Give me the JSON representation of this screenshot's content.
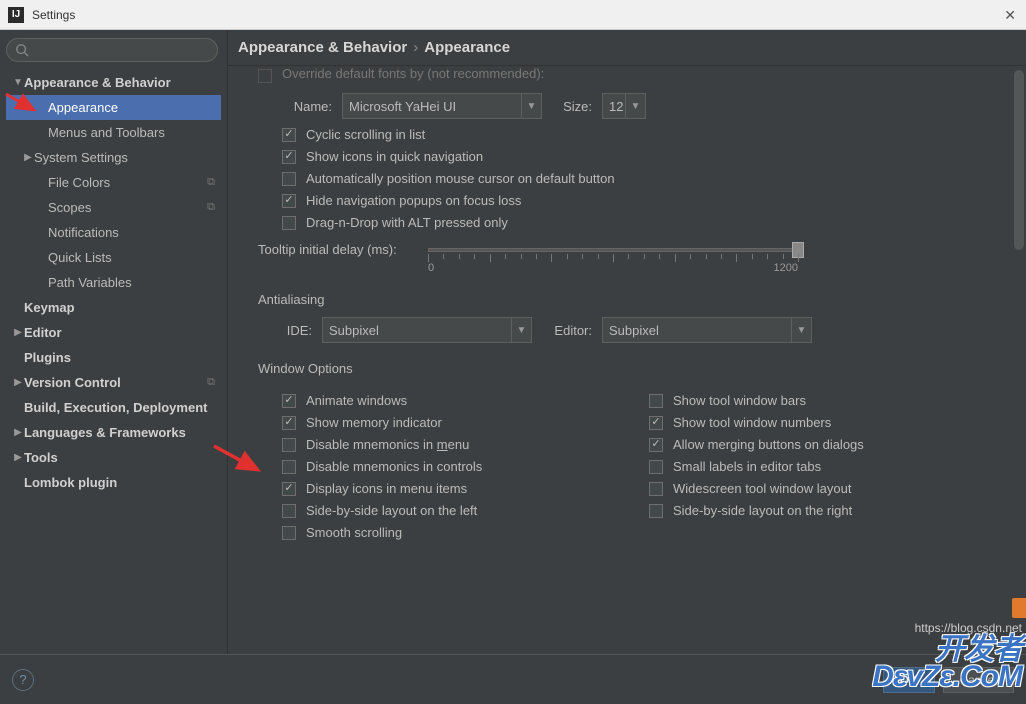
{
  "window": {
    "title": "Settings"
  },
  "breadcrumb": {
    "root": "Appearance & Behavior",
    "leaf": "Appearance"
  },
  "sidebar": {
    "items": [
      {
        "label": "Appearance & Behavior",
        "bold": true,
        "arrow": "down"
      },
      {
        "label": "Appearance",
        "child": true,
        "selected": true
      },
      {
        "label": "Menus and Toolbars",
        "child": true
      },
      {
        "label": "System Settings",
        "child": true,
        "arrow": "right"
      },
      {
        "label": "File Colors",
        "child": true,
        "badge": true
      },
      {
        "label": "Scopes",
        "child": true,
        "badge": true
      },
      {
        "label": "Notifications",
        "child": true
      },
      {
        "label": "Quick Lists",
        "child": true
      },
      {
        "label": "Path Variables",
        "child": true
      },
      {
        "label": "Keymap",
        "bold": true
      },
      {
        "label": "Editor",
        "bold": true,
        "arrow": "right"
      },
      {
        "label": "Plugins",
        "bold": true
      },
      {
        "label": "Version Control",
        "bold": true,
        "arrow": "right",
        "badge": true
      },
      {
        "label": "Build, Execution, Deployment",
        "bold": true
      },
      {
        "label": "Languages & Frameworks",
        "bold": true,
        "arrow": "right"
      },
      {
        "label": "Tools",
        "bold": true,
        "arrow": "right"
      },
      {
        "label": "Lombok plugin",
        "bold": true
      }
    ]
  },
  "font": {
    "override_cutoff": "Override default fonts by (not recommended):",
    "name_label": "Name:",
    "name_value": "Microsoft YaHei UI",
    "size_label": "Size:",
    "size_value": "12"
  },
  "checks_top": [
    {
      "label": "Cyclic scrolling in list",
      "checked": true
    },
    {
      "label": "Show icons in quick navigation",
      "checked": true
    },
    {
      "label": "Automatically position mouse cursor on default button",
      "checked": false
    },
    {
      "label": "Hide navigation popups on focus loss",
      "checked": true
    },
    {
      "label": "Drag-n-Drop with ALT pressed only",
      "checked": false
    }
  ],
  "tooltip": {
    "label": "Tooltip initial delay (ms):",
    "min": "0",
    "max": "1200"
  },
  "antialiasing": {
    "title": "Antialiasing",
    "ide_label": "IDE:",
    "ide_value": "Subpixel",
    "editor_label": "Editor:",
    "editor_value": "Subpixel"
  },
  "window_options": {
    "title": "Window Options",
    "left": [
      {
        "label": "Animate windows",
        "checked": true
      },
      {
        "label": "Show memory indicator",
        "checked": true
      },
      {
        "label": "Disable mnemonics in menu",
        "checked": false,
        "underline": "m"
      },
      {
        "label": "Disable mnemonics in controls",
        "checked": false
      },
      {
        "label": "Display icons in menu items",
        "checked": true
      },
      {
        "label": "Side-by-side layout on the left",
        "checked": false
      },
      {
        "label": "Smooth scrolling",
        "checked": false
      }
    ],
    "right": [
      {
        "label": "Show tool window bars",
        "checked": false
      },
      {
        "label": "Show tool window numbers",
        "checked": true
      },
      {
        "label": "Allow merging buttons on dialogs",
        "checked": true
      },
      {
        "label": "Small labels in editor tabs",
        "checked": false
      },
      {
        "label": "Widescreen tool window layout",
        "checked": false
      },
      {
        "label": "Side-by-side layout on the right",
        "checked": false
      }
    ]
  },
  "footer": {
    "ok": "OK",
    "cancel": "Cancel"
  },
  "watermark": {
    "url": "https://blog.csdn.net",
    "line1": "开发者",
    "line2": "DεvZε.CoM"
  }
}
